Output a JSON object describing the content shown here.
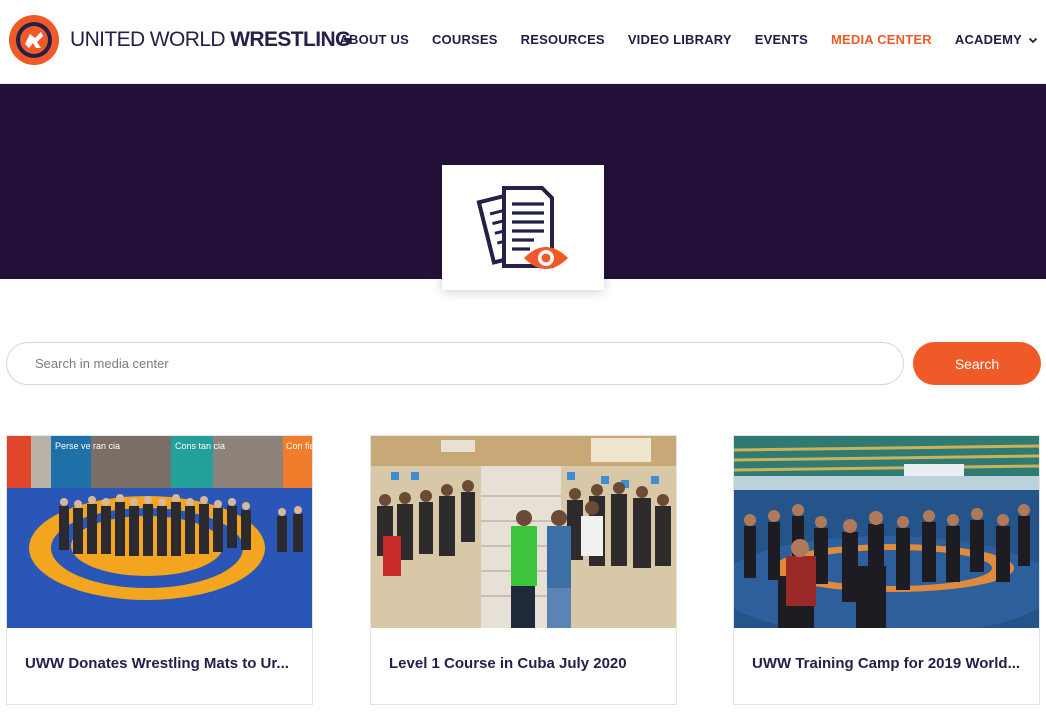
{
  "brand": {
    "name_thin": "UNITED WORLD ",
    "name_bold": "WRESTLING",
    "orange": "#f05a28",
    "navy": "#23214a",
    "hero_color": "#231038"
  },
  "nav": {
    "items": [
      {
        "label": "ABOUT US"
      },
      {
        "label": "COURSES"
      },
      {
        "label": "RESOURCES"
      },
      {
        "label": "VIDEO LIBRARY"
      },
      {
        "label": "EVENTS"
      },
      {
        "label": "MEDIA CENTER",
        "active": true
      },
      {
        "label": "ACADEMY",
        "dropdown": true
      }
    ]
  },
  "hero": {
    "icon": "document-eye-icon"
  },
  "search": {
    "placeholder": "Search in media center",
    "value": "",
    "button_label": "Search"
  },
  "cards": [
    {
      "title": "UWW Donates Wrestling Mats to Ur...",
      "image": "group-photo-on-wrestling-mat",
      "banner_texts": [
        "Perse ve ran cia",
        "Cons tan cia",
        "Con fian za"
      ]
    },
    {
      "title": "Level 1 Course in Cuba July 2020",
      "image": "classroom-course-photo"
    },
    {
      "title": "UWW Training Camp for 2019 World...",
      "image": "arena-training-camp-photo"
    }
  ]
}
